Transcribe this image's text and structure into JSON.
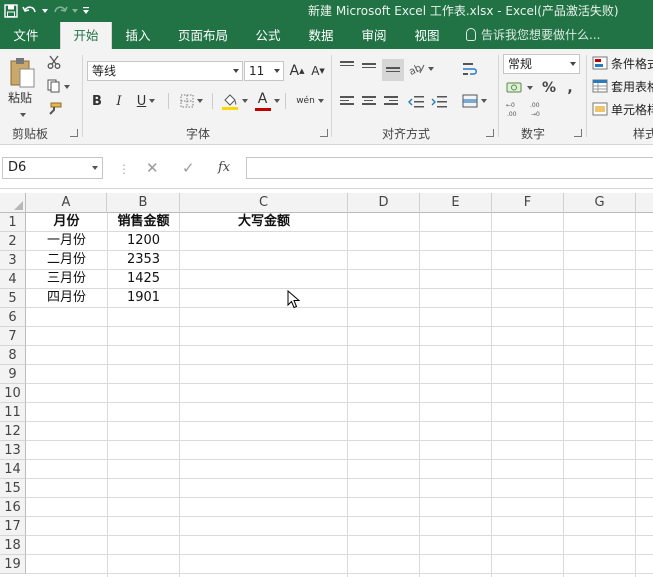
{
  "window": {
    "title": "新建 Microsoft Excel 工作表.xlsx - Excel(产品激活失败)"
  },
  "tabs": [
    {
      "label": "文件"
    },
    {
      "label": "开始"
    },
    {
      "label": "插入"
    },
    {
      "label": "页面布局"
    },
    {
      "label": "公式"
    },
    {
      "label": "数据"
    },
    {
      "label": "审阅"
    },
    {
      "label": "视图"
    }
  ],
  "tellme": {
    "placeholder": "告诉我您想要做什么..."
  },
  "ribbon": {
    "clipboard": {
      "label": "剪贴板",
      "paste_label": "粘贴"
    },
    "font": {
      "label": "字体",
      "font_name": "等线",
      "font_size": "11",
      "bold": "B",
      "italic": "I",
      "underline": "U",
      "grow": "A",
      "shrink": "A",
      "font_color_glyph": "A",
      "phonetic": "wén"
    },
    "alignment": {
      "label": "对齐方式"
    },
    "number": {
      "label": "数字",
      "format": "常规",
      "percent": "%",
      "comma": ","
    },
    "styles": {
      "label": "样式",
      "conditional": "条件格式",
      "table": "套用表格格式",
      "cell": "单元格样式"
    }
  },
  "formula_bar": {
    "name_box": "D6",
    "cancel": "✕",
    "enter": "✓",
    "fx": "fx",
    "formula": ""
  },
  "columns": [
    "A",
    "B",
    "C",
    "D",
    "E",
    "F",
    "G"
  ],
  "rows": [
    "1",
    "2",
    "3",
    "4",
    "5",
    "6",
    "7",
    "8",
    "9",
    "10",
    "11",
    "12",
    "13",
    "14",
    "15",
    "16",
    "17",
    "18",
    "19"
  ],
  "sheet": {
    "headers": [
      "月份",
      "销售金额",
      "大写金额"
    ],
    "data": [
      [
        "一月份",
        "1200",
        ""
      ],
      [
        "二月份",
        "2353",
        ""
      ],
      [
        "三月份",
        "1425",
        ""
      ],
      [
        "四月份",
        "1901",
        ""
      ]
    ]
  },
  "colors": {
    "accent": "#217346",
    "ribbon_bg": "#f3f3f3",
    "font_color_bar": "#c00000",
    "fill_color_bar": "#ffd700"
  }
}
